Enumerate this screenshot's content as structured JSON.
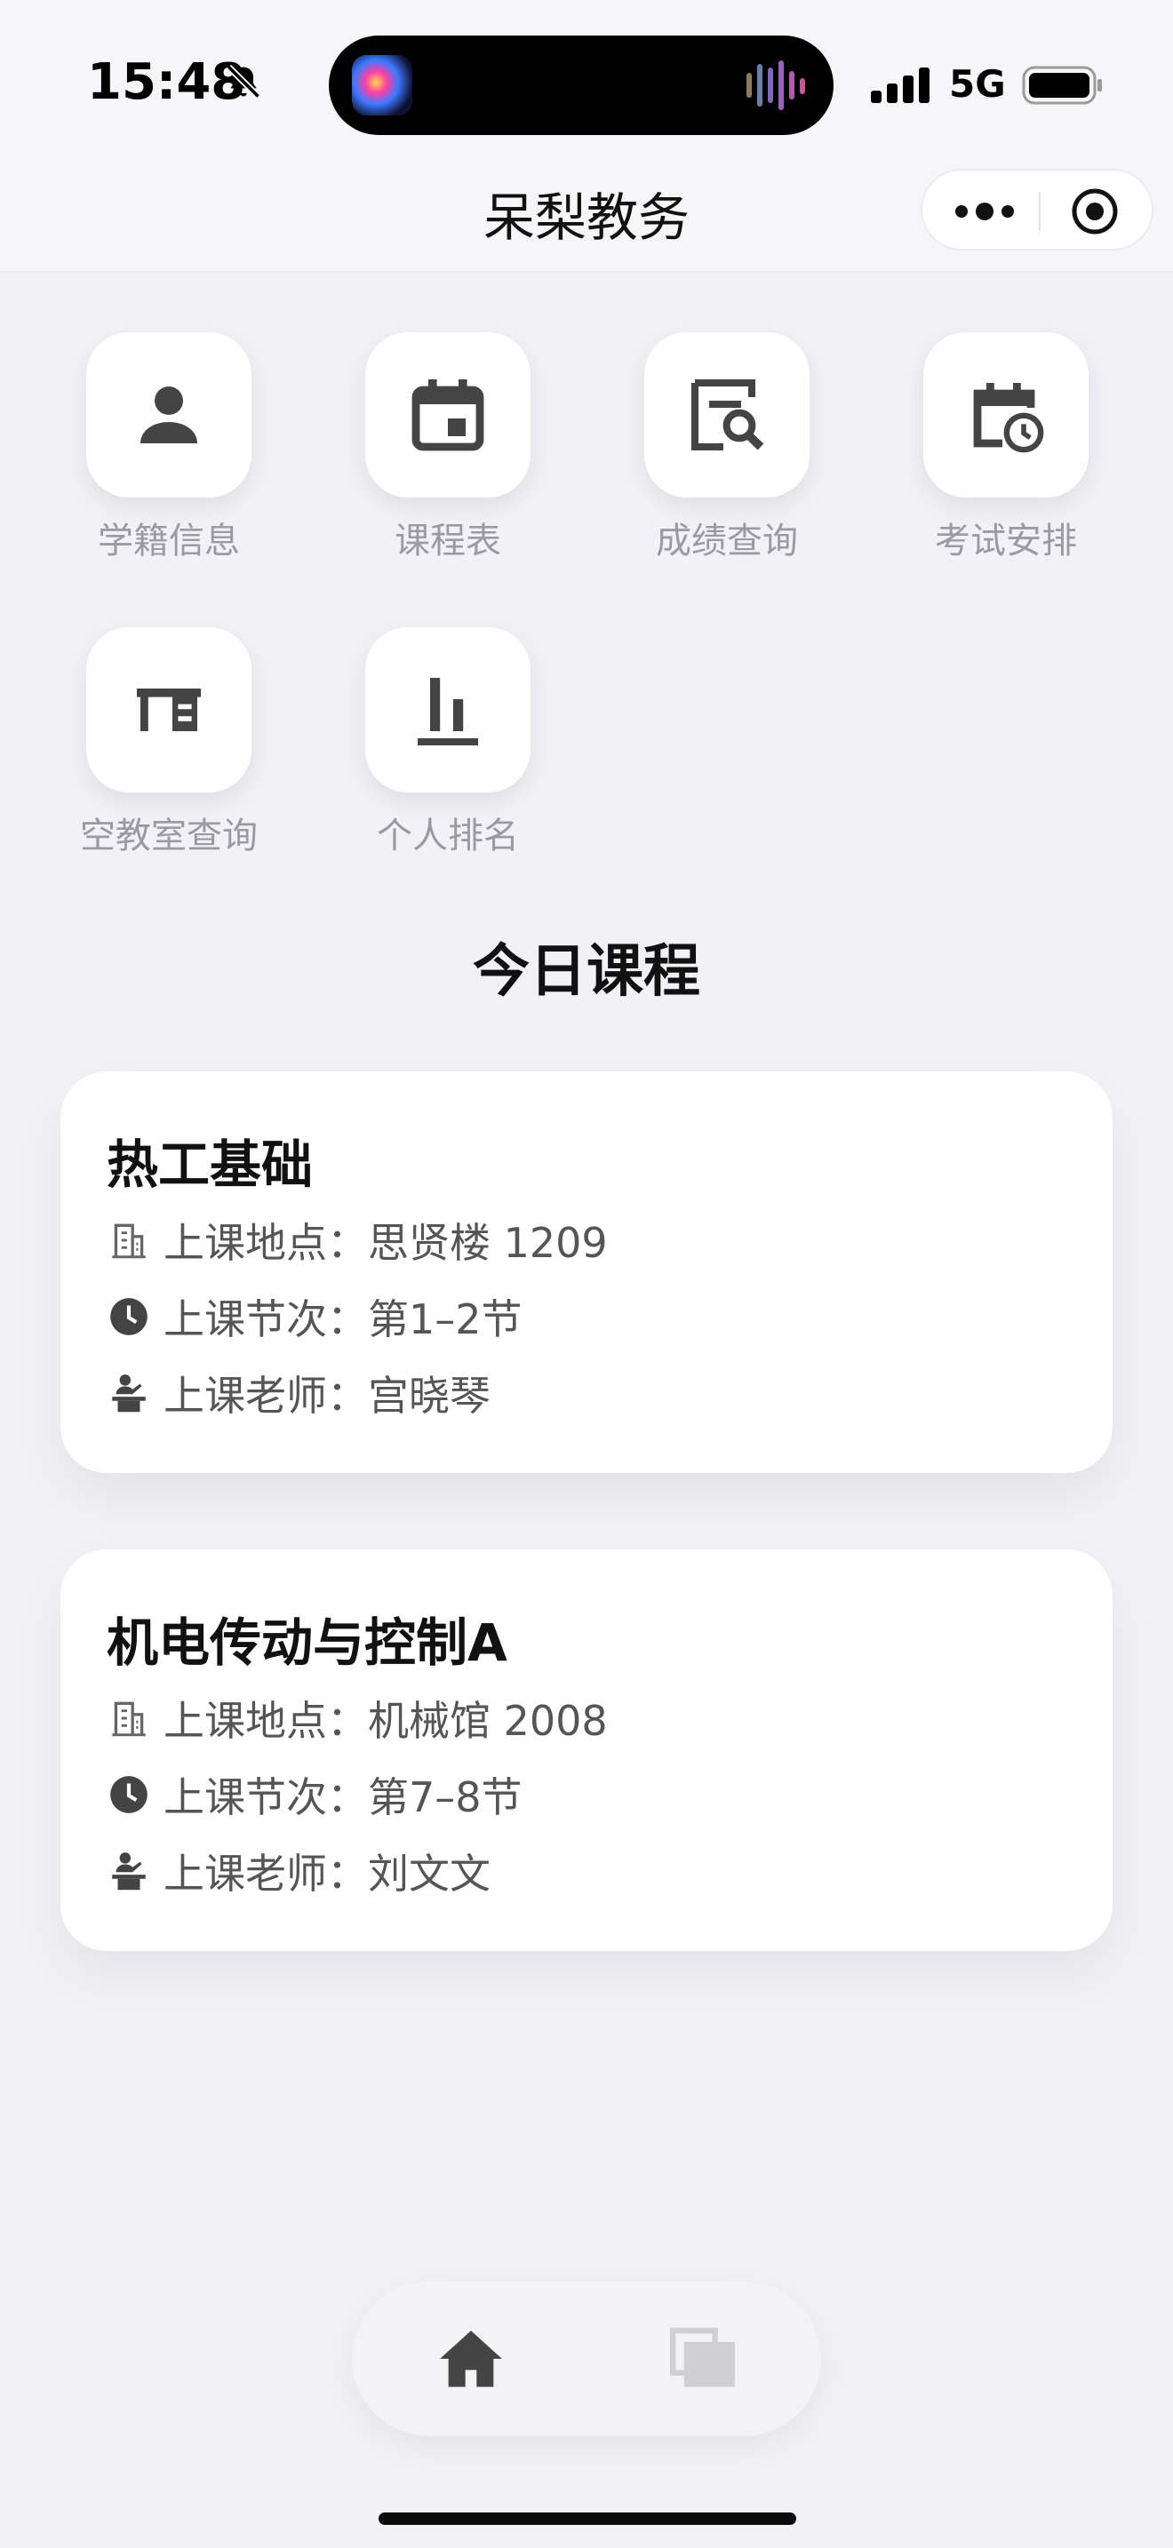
{
  "status_bar": {
    "time": "15:48",
    "network": "5G",
    "icons": [
      "bell-muted-icon",
      "signal-icon",
      "battery-icon"
    ]
  },
  "nav": {
    "title": "呆梨教务",
    "more_icon": "more-dots-icon",
    "close_icon": "target-icon"
  },
  "features": [
    {
      "label": "学籍信息",
      "icon": "person-icon"
    },
    {
      "label": "课程表",
      "icon": "calendar-icon"
    },
    {
      "label": "成绩查询",
      "icon": "grade-search-icon"
    },
    {
      "label": "考试安排",
      "icon": "calendar-clock-icon"
    },
    {
      "label": "空教室查询",
      "icon": "desk-icon"
    },
    {
      "label": "个人排名",
      "icon": "bar-chart-icon"
    }
  ],
  "today": {
    "title": "今日课程",
    "courses": [
      {
        "name": "热工基础",
        "location_label": "上课地点：",
        "location": "思贤楼 1209",
        "period_label": "上课节次：",
        "period": "第1–2节",
        "teacher_label": "上课老师：",
        "teacher": "宫晓琴"
      },
      {
        "name": "机电传动与控制A",
        "location_label": "上课地点：",
        "location": "机械馆 2008",
        "period_label": "上课节次：",
        "period": "第7–8节",
        "teacher_label": "上课老师：",
        "teacher": "刘文文"
      }
    ]
  },
  "tabbar": {
    "tabs": [
      {
        "icon": "home-icon",
        "active": true
      },
      {
        "icon": "copy-icon",
        "active": false
      }
    ]
  },
  "colors": {
    "background": "#f1f1f6",
    "icon": "#444444",
    "label": "#9a9aa2",
    "inactive_tab": "#cfcfd4"
  }
}
